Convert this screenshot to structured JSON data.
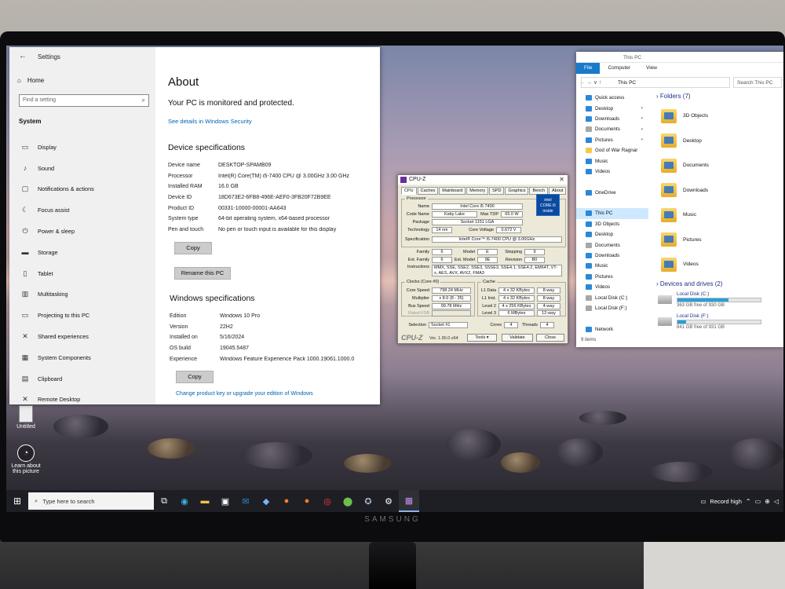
{
  "settings": {
    "window_title": "Settings",
    "home_label": "Home",
    "search_placeholder": "Find a setting",
    "section": "System",
    "nav": [
      "Display",
      "Sound",
      "Notifications & actions",
      "Focus assist",
      "Power & sleep",
      "Storage",
      "Tablet",
      "Multitasking",
      "Projecting to this PC",
      "Shared experiences",
      "System Components",
      "Clipboard",
      "Remote Desktop"
    ],
    "about_title": "About",
    "protected_text": "Your PC is monitored and protected.",
    "security_link": "See details in Windows Security",
    "device_spec_title": "Device specifications",
    "device_specs": [
      {
        "k": "Device name",
        "v": "DESKTOP-SPAMB09"
      },
      {
        "k": "Processor",
        "v": "Intel(R) Core(TM) i5-7400 CPU @ 3.00GHz   3.00 GHz"
      },
      {
        "k": "Installed RAM",
        "v": "16.0 GB"
      },
      {
        "k": "Device ID",
        "v": "18D673E2-6FB8-496E-AEF0-3FB20F72B9EE"
      },
      {
        "k": "Product ID",
        "v": "00331-10000-00001-AA643"
      },
      {
        "k": "System type",
        "v": "64-bit operating system, x64-based processor"
      },
      {
        "k": "Pen and touch",
        "v": "No pen or touch input is available for this display"
      }
    ],
    "copy_label": "Copy",
    "rename_label": "Rename this PC",
    "win_spec_title": "Windows specifications",
    "win_specs": [
      {
        "k": "Edition",
        "v": "Windows 10 Pro"
      },
      {
        "k": "Version",
        "v": "22H2"
      },
      {
        "k": "Installed on",
        "v": "5/16/2024"
      },
      {
        "k": "OS build",
        "v": "19045.5487"
      },
      {
        "k": "Experience",
        "v": "Windows Feature Experience Pack 1000.19061.1000.0"
      }
    ],
    "copy2_label": "Copy",
    "change_link": "Change product key or upgrade your edition of Windows"
  },
  "cpuz": {
    "title": "CPU-Z",
    "tabs": [
      "CPU",
      "Caches",
      "Mainboard",
      "Memory",
      "SPD",
      "Graphics",
      "Bench",
      "About"
    ],
    "processor_group": "Processor",
    "name_label": "Name",
    "name": "Intel Core i5 7400",
    "codename_label": "Code Name",
    "codename": "Kaby Lake",
    "tdp_label": "Max TDP",
    "tdp": "65.0 W",
    "package_label": "Package",
    "package": "Socket 1151 LGA",
    "tech_label": "Technology",
    "tech": "14 nm",
    "voltage_label": "Core Voltage",
    "voltage": "0.672 V",
    "spec_label": "Specification",
    "spec": "Intel® Core™ i5-7400 CPU @ 3.00GHz",
    "family_label": "Family",
    "family": "6",
    "model_label": "Model",
    "model": "E",
    "stepping_label": "Stepping",
    "stepping": "9",
    "extfamily_label": "Ext. Family",
    "extfamily": "6",
    "extmodel_label": "Ext. Model",
    "extmodel": "9E",
    "revision_label": "Revision",
    "revision": "B0",
    "instr_label": "Instructions",
    "instr": "MMX, SSE, SSE2, SSE3, SSSE3, SSE4.1, SSE4.2, EM64T, VT-x, AES, AVX, AVX2, FMA3",
    "clocks_group": "Clocks (Core #0)",
    "corespeed_label": "Core Speed",
    "corespeed": "798.24 MHz",
    "multiplier_label": "Multiplier",
    "multiplier": "x 8.0 (8 - 35)",
    "bus_label": "Bus Speed",
    "bus": "99.78 MHz",
    "fsb_label": "Rated FSB",
    "cache_group": "Cache",
    "l1d_label": "L1 Data",
    "l1d": "4 x 32 KBytes",
    "l1d_way": "8-way",
    "l1i_label": "L1 Inst.",
    "l1i": "4 x 32 KBytes",
    "l1i_way": "8-way",
    "l2_label": "Level 2",
    "l2": "4 x 256 KBytes",
    "l2_way": "4-way",
    "l3_label": "Level 3",
    "l3": "6 MBytes",
    "l3_way": "12-way",
    "selection_label": "Selection",
    "selection": "Socket #1",
    "cores_label": "Cores",
    "cores": "4",
    "threads_label": "Threads",
    "threads": "4",
    "logo": "CPU-Z",
    "version": "Ver. 1.90.0.x64",
    "tools_label": "Tools",
    "validate_label": "Validate",
    "close_label": "Close",
    "intel_badge": [
      "intel",
      "CORE i5",
      "inside"
    ]
  },
  "explorer": {
    "title": "This PC",
    "tabs": [
      "File",
      "Computer",
      "View"
    ],
    "address": "This PC",
    "search_placeholder": "Search This PC",
    "nav": [
      {
        "label": "Quick access",
        "ico": "blue",
        "pin": false
      },
      {
        "label": "Desktop",
        "ico": "blue",
        "pin": true
      },
      {
        "label": "Downloads",
        "ico": "blue",
        "pin": true
      },
      {
        "label": "Documents",
        "ico": "gray",
        "pin": true
      },
      {
        "label": "Pictures",
        "ico": "blue",
        "pin": true
      },
      {
        "label": "God of War Ragnar",
        "ico": "yellow",
        "pin": false
      },
      {
        "label": "Music",
        "ico": "blue",
        "pin": false
      },
      {
        "label": "Videos",
        "ico": "blue",
        "pin": false
      },
      {
        "label": "",
        "ico": "none",
        "pin": false
      },
      {
        "label": "OneDrive",
        "ico": "blue",
        "pin": false
      },
      {
        "label": "",
        "ico": "none",
        "pin": false
      },
      {
        "label": "This PC",
        "ico": "blue",
        "pin": false,
        "sel": true
      },
      {
        "label": "3D Objects",
        "ico": "blue",
        "pin": false
      },
      {
        "label": "Desktop",
        "ico": "blue",
        "pin": false
      },
      {
        "label": "Documents",
        "ico": "gray",
        "pin": false
      },
      {
        "label": "Downloads",
        "ico": "blue",
        "pin": false
      },
      {
        "label": "Music",
        "ico": "blue",
        "pin": false
      },
      {
        "label": "Pictures",
        "ico": "blue",
        "pin": false
      },
      {
        "label": "Videos",
        "ico": "blue",
        "pin": false
      },
      {
        "label": "Local Disk (C:)",
        "ico": "gray",
        "pin": false
      },
      {
        "label": "Local Disk (F:)",
        "ico": "gray",
        "pin": false
      },
      {
        "label": "",
        "ico": "none",
        "pin": false
      },
      {
        "label": "Network",
        "ico": "blue",
        "pin": false
      }
    ],
    "folders_header": "Folders (7)",
    "folders": [
      "3D Objects",
      "Desktop",
      "Documents",
      "Downloads",
      "Music",
      "Pictures",
      "Videos"
    ],
    "drives_header": "Devices and drives (2)",
    "drives": [
      {
        "name": "Local Disk (C:)",
        "free": "363 GB free of 930 GB",
        "used": 0.61
      },
      {
        "name": "Local Disk (F:)",
        "free": "841 GB free of 931 GB",
        "used": 0.1
      }
    ],
    "status": "9 items"
  },
  "desktop": {
    "icons": [
      {
        "label": "Untitled"
      },
      {
        "label": "Learn about this picture"
      }
    ]
  },
  "taskbar": {
    "search_placeholder": "Type here to search",
    "record": "Record high"
  },
  "monitor_brand": "SAMSUNG"
}
